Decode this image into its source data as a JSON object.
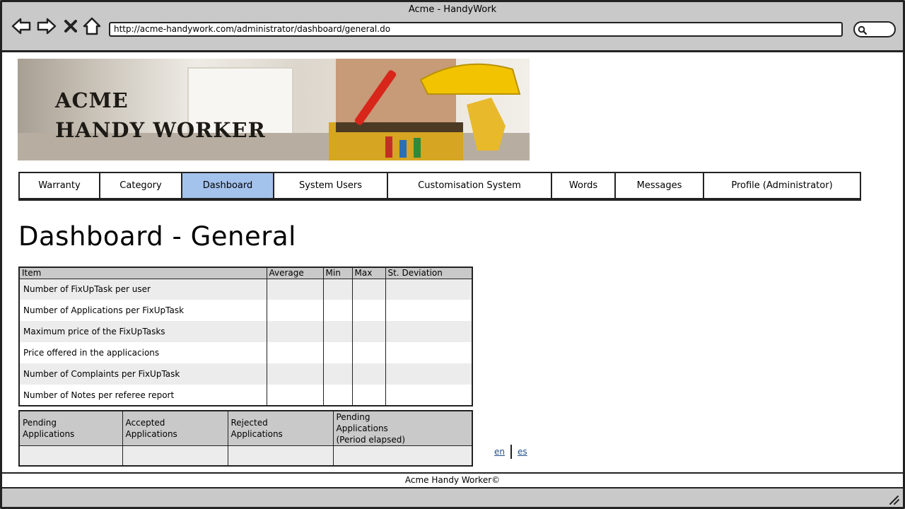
{
  "browser": {
    "title": "Acme - HandyWork",
    "url": "http://acme-handywork.com/administrator/dashboard/general.do"
  },
  "banner": {
    "line1": "ACME",
    "line2": "HANDY WORKER"
  },
  "nav": {
    "items": [
      {
        "label": "Warranty"
      },
      {
        "label": "Category"
      },
      {
        "label": "Dashboard",
        "active": true
      },
      {
        "label": "System Users"
      },
      {
        "label": "Customisation System"
      },
      {
        "label": "Words"
      },
      {
        "label": "Messages"
      },
      {
        "label": "Profile (Administrator)"
      }
    ]
  },
  "page": {
    "title": "Dashboard - General"
  },
  "stats_table": {
    "headers": [
      "Item",
      "Average",
      "Min",
      "Max",
      "St. Deviation"
    ],
    "rows": [
      [
        "Number of FixUpTask per user",
        "",
        "",
        "",
        ""
      ],
      [
        "Number of Applications per FixUpTask",
        "",
        "",
        "",
        ""
      ],
      [
        "Maximum price of the FixUpTasks",
        "",
        "",
        "",
        ""
      ],
      [
        "Price offered in the applicacions",
        "",
        "",
        "",
        ""
      ],
      [
        "Number of Complaints per FixUpTask",
        "",
        "",
        "",
        ""
      ],
      [
        "Number of Notes per referee report",
        "",
        "",
        "",
        ""
      ]
    ]
  },
  "apps_table": {
    "headers": [
      [
        "Pending",
        "Applications"
      ],
      [
        "Accepted",
        "Applications"
      ],
      [
        "Rejected",
        "Applications"
      ],
      [
        "Pending",
        "Applications",
        "(Period elapsed)"
      ]
    ]
  },
  "lang": {
    "en": "en",
    "es": "es"
  },
  "footer": {
    "text": "Acme Handy Worker©"
  },
  "colors": {
    "chrome": "#c9c9c9",
    "active_tab": "#a3c2ec",
    "link": "#1f4f8c",
    "row_alt": "#ececec"
  }
}
